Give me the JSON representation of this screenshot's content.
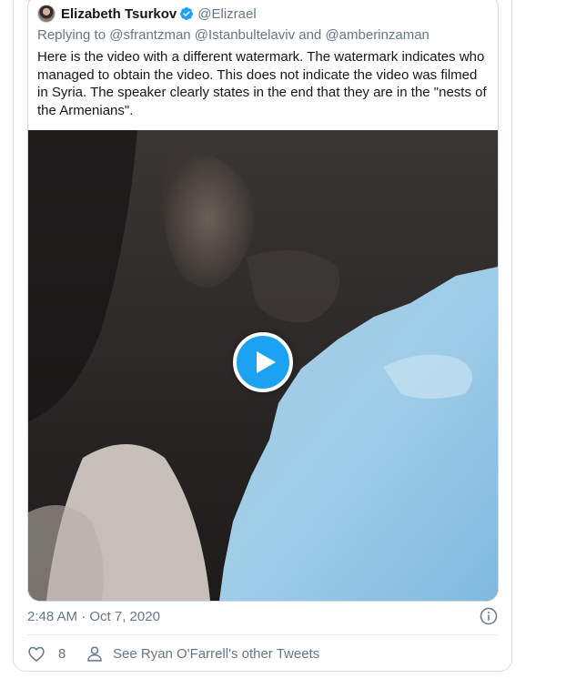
{
  "tweet": {
    "author_name": "Elizabeth Tsurkov",
    "author_handle": "@Elizrael",
    "reply_line": "Replying to @sfrantzman @Istanbultelaviv and @amberinzaman",
    "text": "Here is the video with a different watermark. The watermark indicates who managed to obtain the video. This does not indicate the video was filmed in Syria. The speaker clearly states in the end that they are in the \"nests of the Armenians\".",
    "media": {
      "type": "video",
      "play_icon": "play-icon"
    },
    "verified_icon": "verified-badge-icon"
  },
  "meta": {
    "timestamp": "2:48 AM · Oct 7, 2020",
    "info_icon": "info-icon"
  },
  "actions": {
    "like_icon": "heart-icon",
    "like_count": "8",
    "profile_icon": "person-icon",
    "see_tweets_label": "See Ryan O'Farrell's other Tweets"
  },
  "colors": {
    "accent": "#1da1f2",
    "secondary_text": "#657786",
    "border": "#cfd9de"
  }
}
